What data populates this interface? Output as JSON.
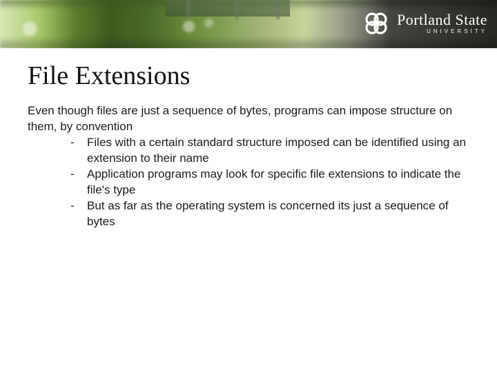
{
  "logo": {
    "name": "Portland State",
    "sub": "UNIVERSITY"
  },
  "slide": {
    "title": "File Extensions",
    "intro": "Even though files are just a sequence of bytes, programs can impose structure on them, by convention",
    "bullets": [
      "Files with a certain standard structure imposed can be identified using an extension to their name",
      "Application programs may look for specific file extensions to indicate the file's type",
      "But as far as the operating system is concerned its just a sequence of bytes"
    ]
  }
}
